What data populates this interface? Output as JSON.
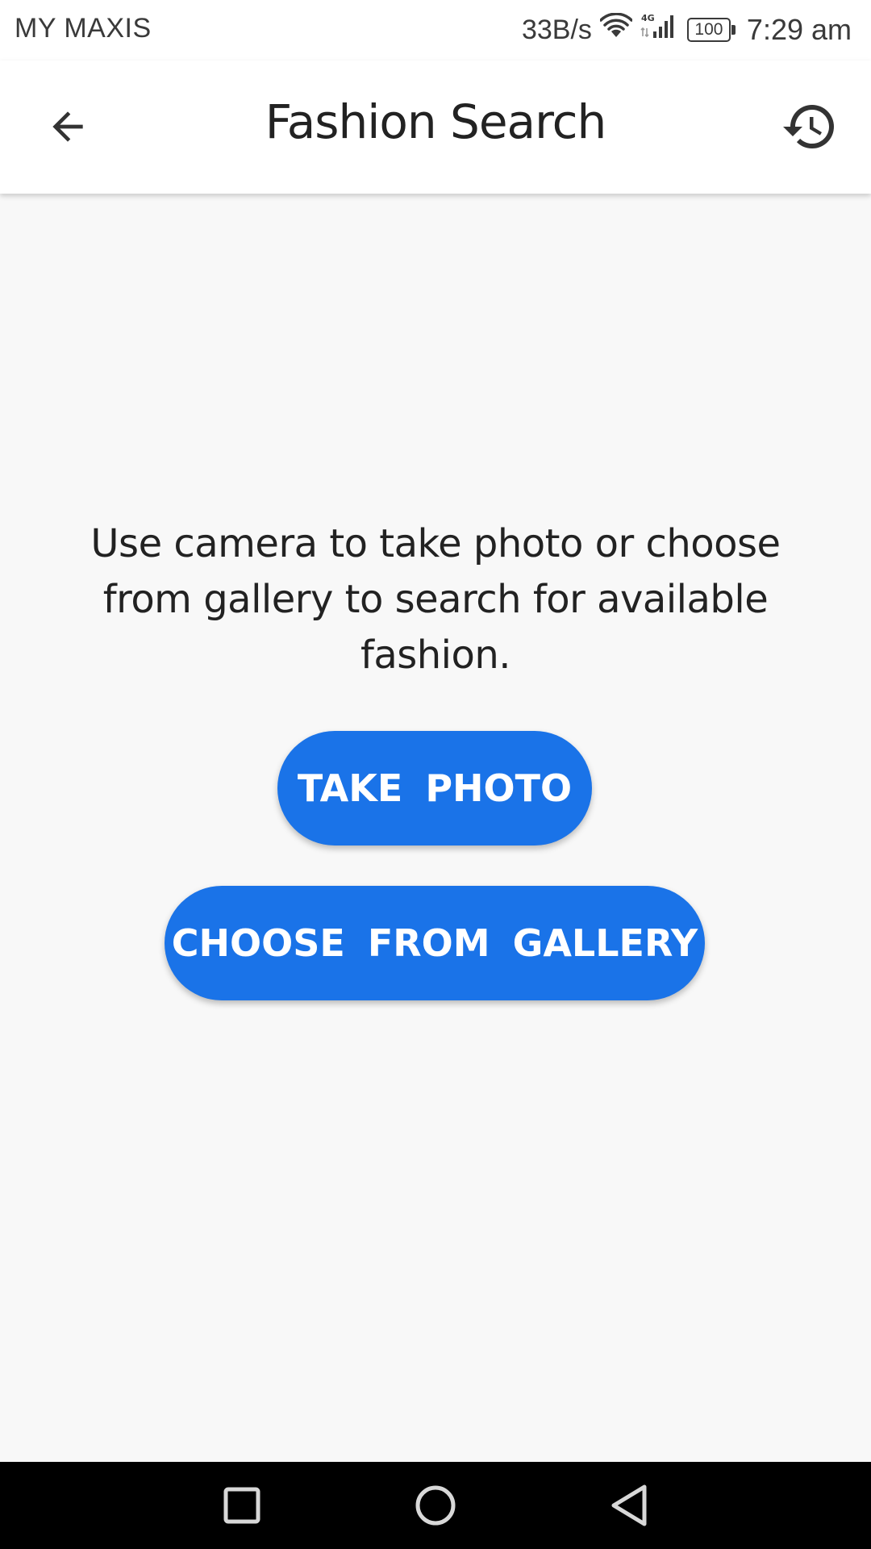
{
  "status_bar": {
    "carrier": "MY MAXIS",
    "net_speed": "33B/s",
    "network_type": "4G",
    "battery": "100",
    "time": "7:29 am"
  },
  "app_bar": {
    "title": "Fashion Search",
    "back_icon": "arrow-back-icon",
    "history_icon": "history-icon"
  },
  "main": {
    "instructions": "Use camera to take photo or choose from gallery to search for available fashion.",
    "take_photo_label": "TAKE PHOTO",
    "choose_gallery_label": "CHOOSE FROM GALLERY"
  },
  "nav_bar": {
    "icons": [
      "recent-apps-icon",
      "home-icon",
      "back-triangle-icon"
    ]
  },
  "colors": {
    "accent": "#1a73e8",
    "background": "#f8f8f8",
    "app_bar": "#ffffff",
    "text": "#222222",
    "nav_bar": "#000000"
  }
}
